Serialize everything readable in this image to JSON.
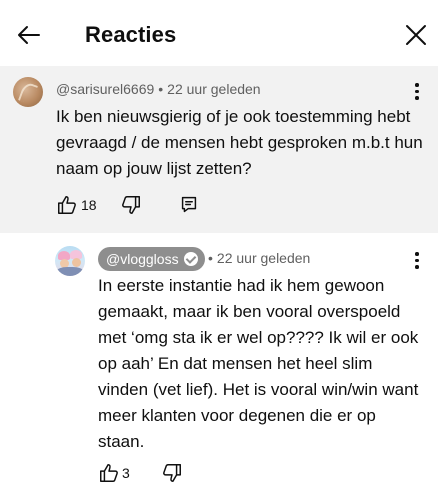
{
  "header": {
    "title": "Reacties"
  },
  "comment": {
    "author": "@sarisurel6669",
    "separator": "•",
    "time": "22 uur geleden",
    "text": "Ik ben nieuwsgierig of je ook toestemming hebt gevraagd / de mensen hebt gesproken m.b.t hun naam op jouw lijst zetten?",
    "like_count": "18"
  },
  "reply": {
    "author": "@vloggloss",
    "verified": true,
    "separator": "•",
    "time": "22 uur geleden",
    "text": "In eerste instantie had ik hem gewoon gemaakt, maar ik ben vooral overspoeld met ‘omg sta ik er wel op???? Ik wil er ook op aah’ En dat mensen het heel slim vinden (vet lief). Het is vooral win/win want meer klanten voor degenen die er op staan.",
    "like_count": "3"
  },
  "icons": {
    "back": "arrow-left-icon",
    "close": "close-icon",
    "menu": "more-vertical-icon",
    "like": "thumbs-up-icon",
    "dislike": "thumbs-down-icon",
    "reply": "comment-reply-icon"
  },
  "colors": {
    "highlighted_comment_bg": "#f2f2f2",
    "meta_text": "#606060",
    "channel_badge": "#8e8e8e"
  }
}
